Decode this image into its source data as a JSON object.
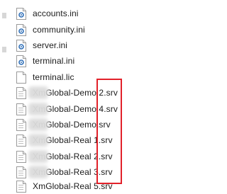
{
  "files": [
    {
      "name": "accounts.ini",
      "icon": "ini-settings-icon"
    },
    {
      "name": "community.ini",
      "icon": "ini-settings-icon"
    },
    {
      "name": "server.ini",
      "icon": "ini-settings-icon"
    },
    {
      "name": "terminal.ini",
      "icon": "ini-settings-icon"
    },
    {
      "name": "terminal.lic",
      "icon": "blank-file-icon"
    },
    {
      "name": "XmGlobal-Demo 2.srv",
      "icon": "srv-file-icon"
    },
    {
      "name": "XmGlobal-Demo 4.srv",
      "icon": "srv-file-icon"
    },
    {
      "name": "XmGlobal-Demo.srv",
      "icon": "srv-file-icon"
    },
    {
      "name": "XmGlobal-Real 1.srv",
      "icon": "srv-file-icon"
    },
    {
      "name": "XmGlobal-Real 2.srv",
      "icon": "srv-file-icon"
    },
    {
      "name": "XmGlobal-Real 3.srv",
      "icon": "srv-file-icon"
    },
    {
      "name": "XmGlobal-Real 5.srv",
      "icon": "srv-file-icon"
    }
  ],
  "colors": {
    "highlight": "#e2212a",
    "text": "#1a1a1a",
    "icon_blue": "#2f6fb8"
  }
}
